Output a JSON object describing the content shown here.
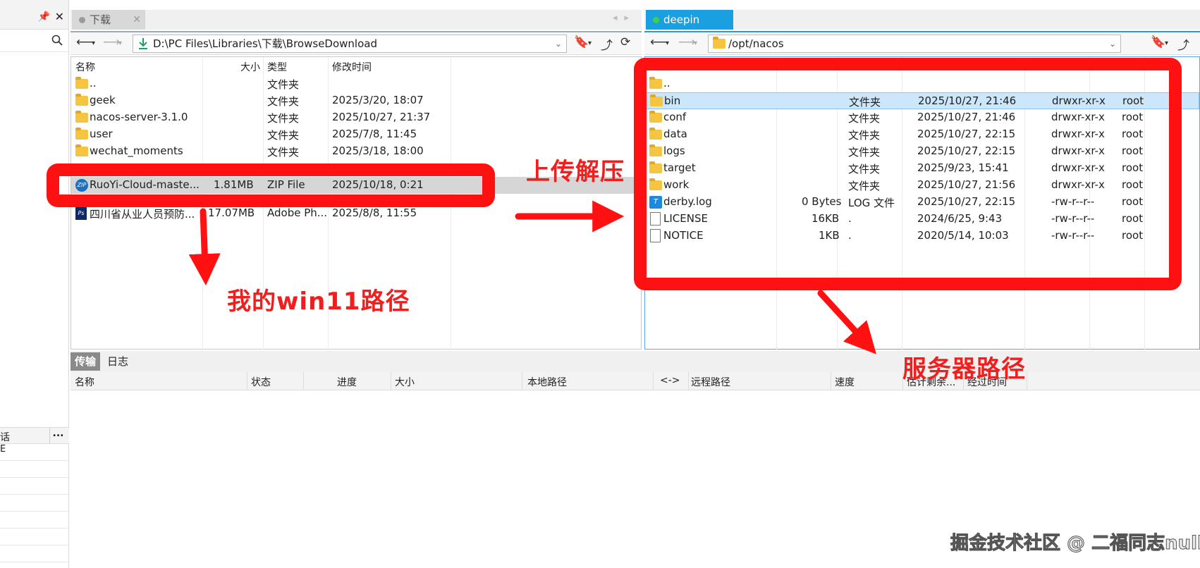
{
  "left_panel": {
    "tab_label": "下载",
    "address": "D:\\PC Files\\Libraries\\下载\\BrowseDownload",
    "columns": {
      "name": "名称",
      "size": "大小",
      "type": "类型",
      "modified": "修改时间"
    },
    "rows": [
      {
        "name": "..",
        "size": "",
        "type": "文件夹",
        "modified": "",
        "icon": "folder-icon"
      },
      {
        "name": "geek",
        "size": "",
        "type": "文件夹",
        "modified": "2025/3/20, 18:07",
        "icon": "folder-icon"
      },
      {
        "name": "nacos-server-3.1.0",
        "size": "",
        "type": "文件夹",
        "modified": "2025/10/27, 21:37",
        "icon": "folder-icon"
      },
      {
        "name": "user",
        "size": "",
        "type": "文件夹",
        "modified": "2025/7/8, 11:45",
        "icon": "folder-icon"
      },
      {
        "name": "wechat_moments",
        "size": "",
        "type": "文件夹",
        "modified": "2025/3/18, 18:00",
        "icon": "folder-icon"
      },
      {
        "name": "RuoYi-Cloud-maste...",
        "size": "1.81MB",
        "type": "ZIP File",
        "modified": "2025/10/18, 0:21",
        "icon": "zip-icon"
      },
      {
        "name": "四川省从业人员预防...",
        "size": "17.07MB",
        "type": "Adobe Ph...",
        "modified": "2025/8/8, 11:55",
        "icon": "pdf-icon"
      }
    ]
  },
  "right_panel": {
    "tab_label": "deepin",
    "address": "/opt/nacos",
    "rows": [
      {
        "name": "..",
        "size": "",
        "type": "",
        "modified": "",
        "perms": "",
        "owner": "",
        "icon": "folder-icon"
      },
      {
        "name": "bin",
        "size": "",
        "type": "文件夹",
        "modified": "2025/10/27, 21:46",
        "perms": "drwxr-xr-x",
        "owner": "root",
        "icon": "folder-icon"
      },
      {
        "name": "conf",
        "size": "",
        "type": "文件夹",
        "modified": "2025/10/27, 21:46",
        "perms": "drwxr-xr-x",
        "owner": "root",
        "icon": "folder-icon"
      },
      {
        "name": "data",
        "size": "",
        "type": "文件夹",
        "modified": "2025/10/27, 22:15",
        "perms": "drwxr-xr-x",
        "owner": "root",
        "icon": "folder-icon"
      },
      {
        "name": "logs",
        "size": "",
        "type": "文件夹",
        "modified": "2025/10/27, 22:15",
        "perms": "drwxr-xr-x",
        "owner": "root",
        "icon": "folder-icon"
      },
      {
        "name": "target",
        "size": "",
        "type": "文件夹",
        "modified": "2025/9/23, 15:41",
        "perms": "drwxr-xr-x",
        "owner": "root",
        "icon": "folder-icon"
      },
      {
        "name": "work",
        "size": "",
        "type": "文件夹",
        "modified": "2025/10/27, 21:56",
        "perms": "drwxr-xr-x",
        "owner": "root",
        "icon": "folder-icon"
      },
      {
        "name": "derby.log",
        "size": "0 Bytes",
        "type": "LOG 文件",
        "modified": "2025/10/27, 22:15",
        "perms": "-rw-r--r--",
        "owner": "root",
        "icon": "log-icon"
      },
      {
        "name": "LICENSE",
        "size": "16KB",
        "type": ".",
        "modified": "2024/6/25, 9:43",
        "perms": "-rw-r--r--",
        "owner": "root",
        "icon": "file-icon"
      },
      {
        "name": "NOTICE",
        "size": "1KB",
        "type": ".",
        "modified": "2020/5/14, 10:03",
        "perms": "-rw-r--r--",
        "owner": "root",
        "icon": "file-icon"
      }
    ]
  },
  "side_strip": {
    "session_header": "话",
    "session_more": "...",
    "session_row1": "E"
  },
  "transfer": {
    "tab_transfer": "传输",
    "tab_log": "日志",
    "columns": {
      "name": "名称",
      "status": "状态",
      "progress": "进度",
      "size": "大小",
      "local": "本地路径",
      "dir": "<->",
      "remote": "远程路径",
      "speed": "速度",
      "eta": "估计剩余...",
      "elapsed": "经过时间"
    }
  },
  "annotations": {
    "upload": "上传解压",
    "local_path": "我的win11路径",
    "server_path": "服务器路径",
    "watermark": "掘金技术社区 @ 二福同志null",
    "color": "#ff1111"
  }
}
